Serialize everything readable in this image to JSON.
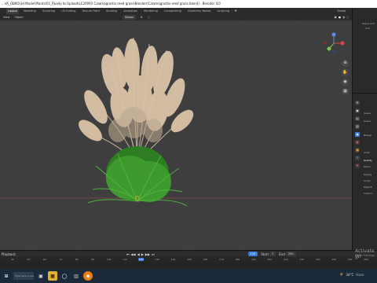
{
  "window": {
    "title": "...VA_OBKO\\3d Model\\Plants\\01_Ready to Upload\\LC20095 Calamagrostis reed grass\\Blender\\Calamagrostis-reed grass.blend] - Blender 4.0"
  },
  "menu": {
    "tabs": [
      "Layout",
      "Modeling",
      "Sculpting",
      "UV Editing",
      "Texture Paint",
      "Shading",
      "Animation",
      "Rendering",
      "Compositing",
      "Geometry Nodes",
      "Scripting"
    ],
    "add_label": "+",
    "scene_label": "Scene"
  },
  "viewport_header": {
    "view": "View",
    "object": "Object",
    "orientation": "Global",
    "options": "Options"
  },
  "right_panel": {
    "outliner_rows": [
      "Scene Coll",
      "Coll"
    ],
    "properties_rows": [
      "Scene",
      "Scene",
      "Backgr",
      "Units",
      "Gravity",
      "Simul",
      "Keying",
      "Audio",
      "Rigid B",
      "Custom"
    ]
  },
  "timeline": {
    "controls": [
      "Playback",
      "Keying",
      "View",
      "Marker"
    ],
    "ticks": [
      "40",
      "50",
      "60",
      "70",
      "80",
      "90",
      "100",
      "110",
      "120",
      "130",
      "140",
      "150",
      "160",
      "170",
      "180",
      "190",
      "200",
      "210",
      "220",
      "230",
      "240",
      "250",
      "260"
    ],
    "current_frame": "120",
    "start_label": "Start",
    "start_value": "1",
    "end_label": "End",
    "end_value": "250"
  },
  "watermark": {
    "line1": "Activate Wi",
    "line2": "Go to Settings to"
  },
  "taskbar": {
    "search_placeholder": "Type here to search",
    "temperature": "34°C",
    "weather": "Haze"
  },
  "colors": {
    "accent": "#3d7bd8",
    "viewport_bg": "#3e3e3e",
    "grass": "#3e9a2e",
    "plume": "#d9c3a8"
  }
}
